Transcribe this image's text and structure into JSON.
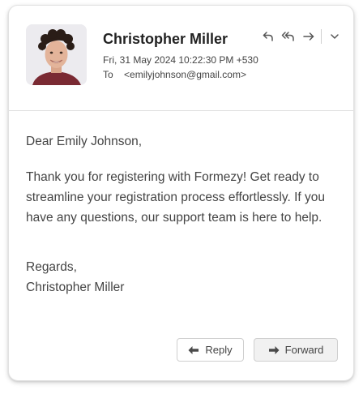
{
  "email": {
    "sender_name": "Christopher Miller",
    "date": "Fri, 31 May 2024  10:22:30 PM +530",
    "to_label": "To",
    "to_address": "<emilyjohnson@gmail.com>",
    "greeting": "Dear Emily Johnson,",
    "body": "Thank you for registering with Formezy! Get ready to streamline your registration process effortlessly. If you have any questions, our support team is here to help.",
    "closing": "Regards,",
    "signature": "Christopher Miller"
  },
  "toolbar": {
    "icons": [
      "reply-icon",
      "reply-all-icon",
      "forward-icon",
      "chevron-down-icon"
    ]
  },
  "buttons": {
    "reply_label": "Reply",
    "forward_label": "Forward"
  },
  "colors": {
    "text": "#444444",
    "title": "#222222",
    "border": "#dedede",
    "forward_button_bg": "#f1f1f1"
  }
}
